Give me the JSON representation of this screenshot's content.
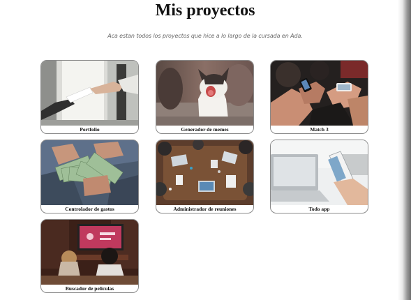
{
  "header": {
    "title": "Mis proyectos",
    "subtitle": "Aca estan todos los proyectos que hice a lo largo de la cursada en Ada."
  },
  "projects": [
    {
      "label": "Portfolio",
      "image": "handshake-papers-photo"
    },
    {
      "label": "Generador de memes",
      "image": "yawning-cat-photo"
    },
    {
      "label": "Match 3",
      "image": "people-holding-phones-photo"
    },
    {
      "label": "Controlador de gastos",
      "image": "hands-counting-dollars-photo"
    },
    {
      "label": "Administrador de reuniones",
      "image": "meeting-table-laptops-photo"
    },
    {
      "label": "Todo app",
      "image": "hand-holding-phone-laptop-photo"
    },
    {
      "label": "Buscador de peliculas",
      "image": "couple-watching-tv-photo"
    }
  ],
  "colors": {
    "background": "#ffffff",
    "card_border": "#8a8a8a",
    "text": "#111111",
    "subtitle": "#666666"
  }
}
